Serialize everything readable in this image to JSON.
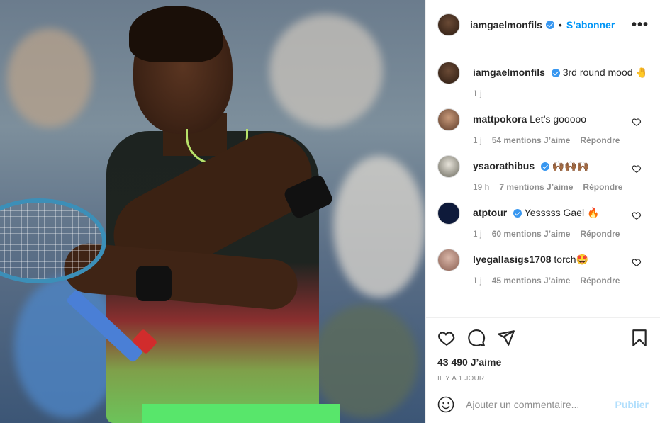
{
  "post": {
    "author": "iamgaelmonfils",
    "follow_label": "S’abonner",
    "separator": "•",
    "more_label": "•••",
    "caption": "3rd round mood",
    "caption_emoji": "🤚",
    "caption_time": "1 j",
    "likes": "43 490 J’aime",
    "time_ago": "IL Y A 1 JOUR"
  },
  "comments": [
    {
      "user": "mattpokora",
      "verified": false,
      "text": "Let’s gooooo",
      "time": "1 j",
      "likes": "54 mentions J’aime",
      "reply": "Répondre"
    },
    {
      "user": "ysaorathibus",
      "verified": true,
      "text": "🙌🏾🙌🏾🙌🏾",
      "time": "19 h",
      "likes": "7 mentions J’aime",
      "reply": "Répondre"
    },
    {
      "user": "atptour",
      "verified": true,
      "text": "Yesssss Gael 🔥",
      "time": "1 j",
      "likes": "60 mentions J’aime",
      "reply": "Répondre"
    },
    {
      "user": "lyegallasigs1708",
      "verified": false,
      "text": "torch🤩",
      "time": "1 j",
      "likes": "45 mentions J’aime",
      "reply": "Répondre"
    }
  ],
  "add_comment": {
    "placeholder": "Ajouter un commentaire...",
    "publish_label": "Publier"
  },
  "icons": {
    "like": "heart-icon",
    "comment": "comment-icon",
    "share": "share-icon",
    "save": "bookmark-icon",
    "emoji": "emoji-icon"
  },
  "colors": {
    "accent": "#0095f6",
    "verified": "#3897f0",
    "muted": "#8e8e8e",
    "publish_disabled": "#b2dffc"
  }
}
